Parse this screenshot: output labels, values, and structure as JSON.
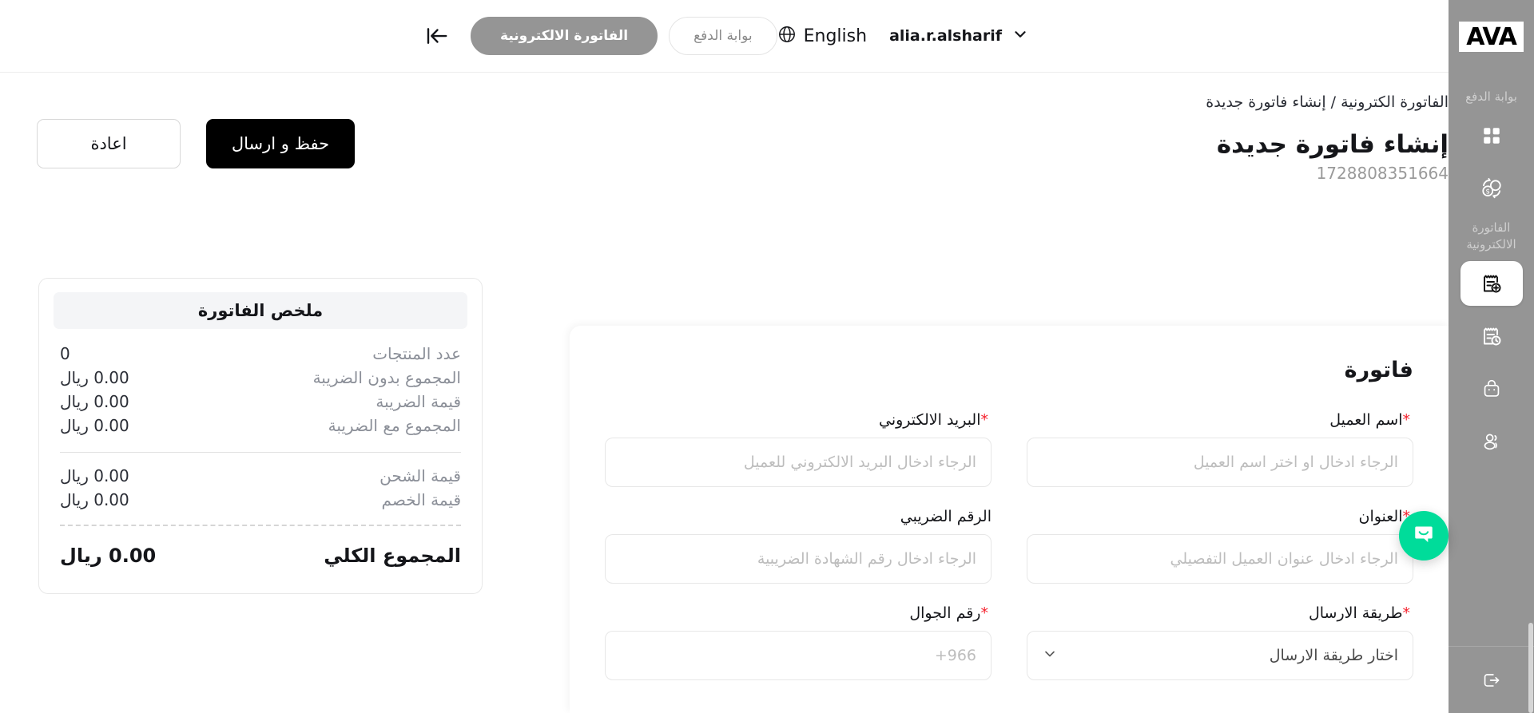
{
  "header": {
    "user_name": "alia.r.alsharif",
    "chevron_icon": "chevron-down-icon",
    "language_label": "English",
    "globe_icon": "globe-icon",
    "payment_gateway_pill": "بوابة الدفع",
    "einvoice_pill": "الفاتورة الالكترونية",
    "collapse_icon": "collapse-sidebar-icon"
  },
  "sidebar": {
    "logo_text": "AVA",
    "sections": [
      {
        "label": "بوابة الدفع",
        "items": [
          {
            "icon": "grid-dashboard-icon",
            "active": false
          },
          {
            "icon": "money-exchange-icon",
            "active": false
          }
        ]
      },
      {
        "label": "الفاتورة الالكترونية",
        "items": [
          {
            "icon": "invoice-add-icon",
            "active": true
          },
          {
            "icon": "invoice-history-icon",
            "active": false
          },
          {
            "icon": "bag-icon",
            "active": false
          },
          {
            "icon": "users-icon",
            "active": false
          }
        ]
      }
    ],
    "logout_icon": "logout-icon",
    "chat_icon": "chat-bubble-icon",
    "accent_green": "#00dc9a",
    "background": "#959595"
  },
  "page": {
    "breadcrumb": "الفاتورة الكترونية / إنشاء فاتورة جديدة",
    "title": "إنشاء فاتورة جديدة",
    "invoice_id": "1728808351664",
    "actions": {
      "save_send_label": "حفظ و ارسال",
      "reset_label": "اعادة"
    }
  },
  "form": {
    "section_title": "فاتورة",
    "fields": {
      "customer_name": {
        "label": "اسم العميل",
        "required": true,
        "value": "",
        "placeholder": "الرجاء ادخال او اختر اسم العميل"
      },
      "email": {
        "label": "البريد الالكتروني",
        "required": true,
        "value": "",
        "placeholder": "الرجاء ادخال البريد الالكتروني للعميل"
      },
      "address": {
        "label": "العنوان",
        "required": true,
        "value": "",
        "placeholder": "الرجاء ادخال عنوان العميل التفصيلي"
      },
      "tax_number": {
        "label": "الرقم الضريبي",
        "required": false,
        "value": "",
        "placeholder": "الرجاء ادخال رقم الشهادة الضريبية"
      },
      "send_method": {
        "label": "طريقة الارسال",
        "required": true,
        "value": "اختار طريقة الارسال",
        "chevron_icon": "chevron-down-icon"
      },
      "mobile": {
        "label": "رقم الجوال",
        "required": true,
        "value": "",
        "placeholder": "+966"
      }
    }
  },
  "summary": {
    "title": "ملخص الفاتورة",
    "rows": [
      {
        "label": "عدد المنتجات",
        "value": "0"
      },
      {
        "label": "المجموع بدون الضريبة",
        "value": "0.00 ريال"
      },
      {
        "label": "قيمة الضريبة",
        "value": "0.00 ريال"
      },
      {
        "label": "المجموع مع الضريبة",
        "value": "0.00 ريال"
      }
    ],
    "rows2": [
      {
        "label": "قيمة الشحن",
        "value": "0.00 ريال"
      },
      {
        "label": "قيمة الخصم",
        "value": "0.00 ريال"
      }
    ],
    "total": {
      "label": "المجموع الكلي",
      "value": "0.00 ريال"
    }
  }
}
